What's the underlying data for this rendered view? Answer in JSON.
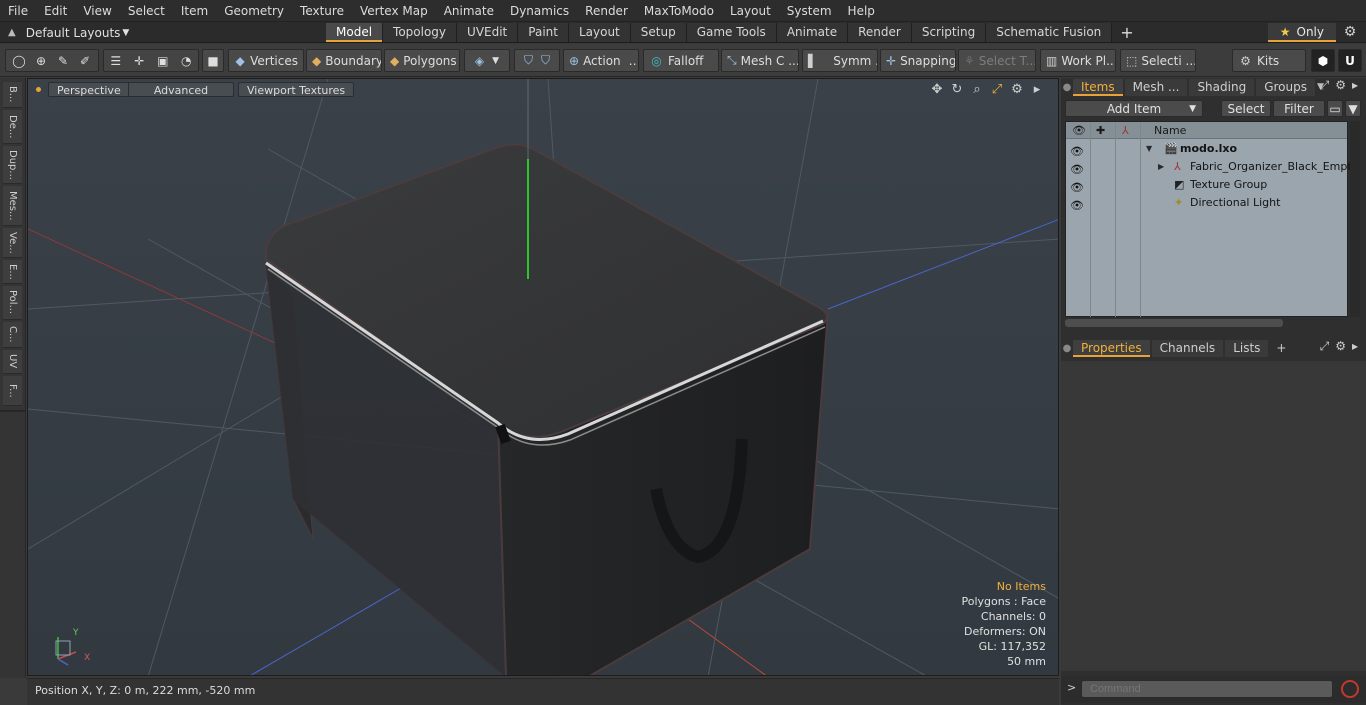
{
  "menu": [
    "File",
    "Edit",
    "View",
    "Select",
    "Item",
    "Geometry",
    "Texture",
    "Vertex Map",
    "Animate",
    "Dynamics",
    "Render",
    "MaxToModo",
    "Layout",
    "System",
    "Help"
  ],
  "layout_selector": "Default Layouts",
  "workspace_tabs": [
    "Model",
    "Topology",
    "UVEdit",
    "Paint",
    "Layout",
    "Setup",
    "Game Tools",
    "Animate",
    "Render",
    "Scripting",
    "Schematic Fusion"
  ],
  "active_workspace": "Model",
  "only_label": "Only",
  "toolbar": {
    "vertices": "Vertices",
    "boundary": "Boundary",
    "polygons": "Polygons",
    "action": "Action",
    "falloff": "Falloff",
    "mesh": "Mesh C ...",
    "symmetry": "Symm ...",
    "snapping": "Snapping",
    "select_through": "Select T...",
    "work_plane": "Work Pl...",
    "selection": "Selecti ...",
    "kits": "Kits"
  },
  "left_tabs": [
    "B...",
    "De...",
    "Dup...",
    "Mes...",
    "Ve...",
    "E...",
    "Pol...",
    "C...",
    "UV",
    "F..."
  ],
  "viewport": {
    "mode": "Perspective",
    "shading": "Advanced",
    "textures": "Viewport Textures",
    "info": {
      "selection": "No Items",
      "polygons": "Polygons : Face",
      "channels": "Channels: 0",
      "deformers": "Deformers: ON",
      "gl": "GL: 117,352",
      "grid": "50 mm"
    },
    "axis_labels": {
      "y": "Y",
      "x": "X"
    }
  },
  "status": {
    "position": "Position X, Y, Z:   0 m, 222 mm, -520 mm"
  },
  "right_panel": {
    "top_tabs": [
      "Items",
      "Mesh ...",
      "Shading",
      "Groups"
    ],
    "active_top_tab": "Items",
    "add_item": "Add Item",
    "select": "Select",
    "filter": "Filter",
    "column_name": "Name",
    "tree": [
      {
        "label": "modo.lxo",
        "depth": 0,
        "expanded": true
      },
      {
        "label": "Fabric_Organizer_Black_Empty",
        "depth": 1,
        "expanded": false
      },
      {
        "label": "Texture Group",
        "depth": 1
      },
      {
        "label": "Directional Light",
        "depth": 1
      }
    ],
    "bottom_tabs": [
      "Properties",
      "Channels",
      "Lists"
    ],
    "active_bottom_tab": "Properties",
    "command_placeholder": "Command"
  },
  "colors": {
    "accent": "#e8a23a",
    "viewport_bg": "#353c43",
    "item_list_bg": "#9aa5ad"
  }
}
